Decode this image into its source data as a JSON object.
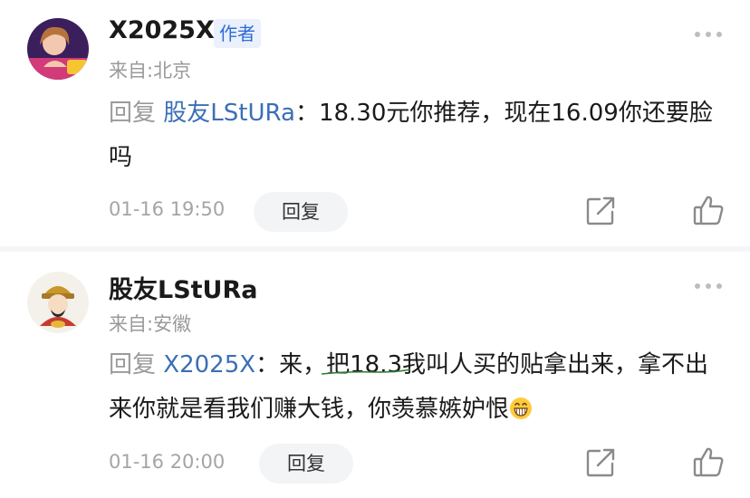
{
  "comments": [
    {
      "username": "X2025X",
      "badge": "作者",
      "location": "来自:北京",
      "reply_prefix": "回复",
      "reply_target": "股友LStURa",
      "reply_separator": "：",
      "reply_body": "18.30元你推荐，现在16.09你还要脸吗",
      "timestamp": "01-16 19:50",
      "reply_button": "回复",
      "avatar_icon": "user-avatar-icon"
    },
    {
      "username": "股友LStURa",
      "location": "来自:安徽",
      "reply_prefix": "回复",
      "reply_target": "X2025X",
      "reply_separator": "：",
      "reply_body_start": "来，",
      "reply_body_underlined": "把18.3我叫人买的贴拿出来，",
      "reply_body_end": "拿不出来你就是看我们赚大钱，你羡慕嫉妒恨",
      "timestamp": "01-16 20:00",
      "reply_button": "回复",
      "emoji": "grinning-emoji-icon",
      "avatar_icon": "caishen-avatar-icon"
    }
  ],
  "colors": {
    "link_blue": "#3b6fb6",
    "badge_blue": "#2f6bd6",
    "badge_bg": "#eaf1fc",
    "muted_text": "#9a9a9a",
    "underline_green": "#2e7d32"
  }
}
